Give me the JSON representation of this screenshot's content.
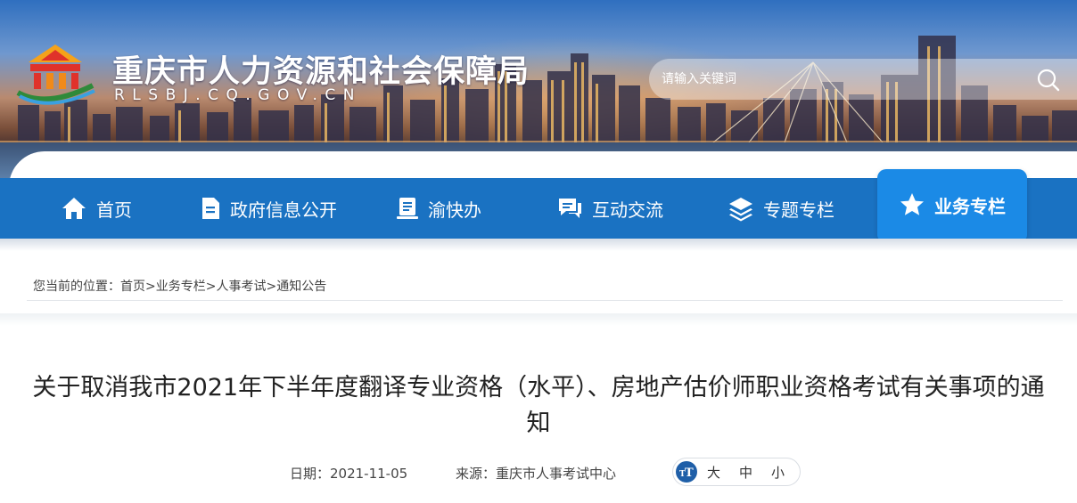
{
  "header": {
    "site_title": "重庆市人力资源和社会保障局",
    "site_domain": "RLSBJ.CQ.GOV.CN",
    "search": {
      "placeholder": "请输入关键词",
      "icon": "search-icon"
    }
  },
  "nav": {
    "items": [
      {
        "label": "首页",
        "icon": "home-icon"
      },
      {
        "label": "政府信息公开",
        "icon": "document-icon"
      },
      {
        "label": "渝快办",
        "icon": "clipboard-icon"
      },
      {
        "label": "互动交流",
        "icon": "chat-icon"
      },
      {
        "label": "专题专栏",
        "icon": "layers-icon"
      },
      {
        "label": "业务专栏",
        "icon": "star-icon",
        "active": true
      }
    ]
  },
  "breadcrumb": {
    "prefix": "您当前的位置：",
    "items": [
      "首页",
      "业务专栏",
      "人事考试",
      "通知公告"
    ],
    "separator": ">"
  },
  "article": {
    "title": "关于取消我市2021年下半年度翻译专业资格（水平）、房地产估价师职业资格考试有关事项的通知",
    "date_label": "日期：2021-11-05",
    "source_label": "来源：重庆市人事考试中心",
    "font_size": {
      "icon": "font-size-icon",
      "options": [
        "大",
        "中",
        "小"
      ]
    }
  },
  "colors": {
    "nav_bg": "#1a72c2",
    "nav_active_bg": "#1b8ae6",
    "title_text": "#222222"
  }
}
